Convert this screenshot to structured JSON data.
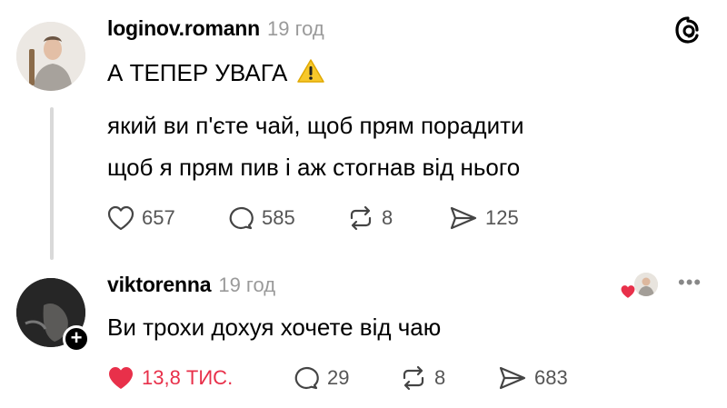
{
  "post": {
    "username": "loginov.romann",
    "time": "19 год",
    "title": "А ТЕПЕР УВАГА",
    "title_icon": "warning-icon",
    "lines": [
      "який ви п'єте чай, щоб прям порадити",
      "щоб я прям пив і аж стогнав від нього"
    ],
    "likes": "657",
    "replies": "585",
    "reposts": "8",
    "shares": "125"
  },
  "reply": {
    "username": "viktorenna",
    "time": "19 год",
    "text": "Ви трохи дохуя хочете від чаю",
    "likes": "13,8 ТИС.",
    "replies": "29",
    "reposts": "8",
    "shares": "683",
    "liked": true,
    "like_color": "#e8304a"
  },
  "app": {
    "logo": "threads-icon"
  }
}
